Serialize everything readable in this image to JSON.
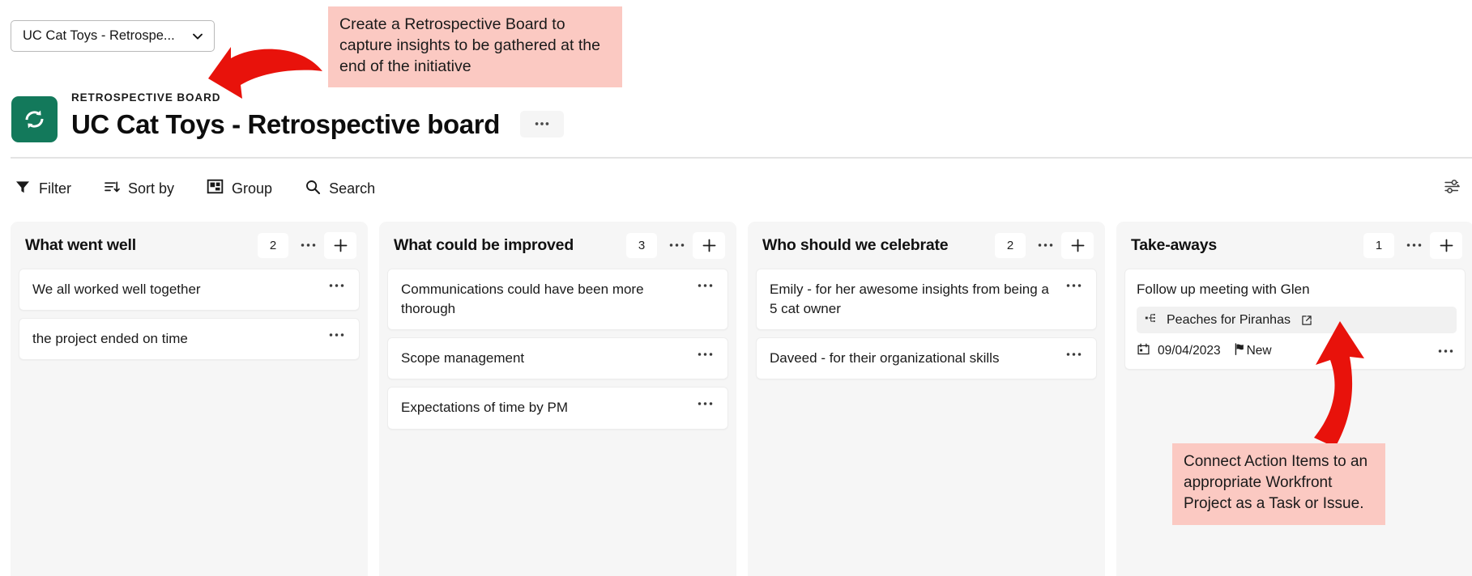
{
  "board_selector": {
    "value": "UC Cat Toys - Retrospe...",
    "icon": "chevron-down-icon"
  },
  "header": {
    "eyebrow": "RETROSPECTIVE BOARD",
    "title": "UC Cat Toys - Retrospective board",
    "more_label": "•••",
    "icon": "sync-refresh-icon",
    "accent_color": "#13795b"
  },
  "toolbar": {
    "items": [
      {
        "label": "Filter",
        "icon": "filter-icon"
      },
      {
        "label": "Sort by",
        "icon": "sort-icon"
      },
      {
        "label": "Group",
        "icon": "group-icon"
      },
      {
        "label": "Search",
        "icon": "search-icon"
      }
    ],
    "settings_icon": "sliders-settings-icon"
  },
  "columns": [
    {
      "title": "What went well",
      "count": "2",
      "more_label": "•••",
      "add_label": "+",
      "cards": [
        {
          "text": "We all worked well together",
          "dots": "•••"
        },
        {
          "text": "the project ended on time",
          "dots": "•••"
        }
      ]
    },
    {
      "title": "What could be improved",
      "count": "3",
      "more_label": "•••",
      "add_label": "+",
      "cards": [
        {
          "text": "Communications could have been more thorough",
          "dots": "•••"
        },
        {
          "text": "Scope management",
          "dots": "•••"
        },
        {
          "text": "Expectations of time by PM",
          "dots": "•••"
        }
      ]
    },
    {
      "title": "Who should we celebrate",
      "count": "2",
      "more_label": "•••",
      "add_label": "+",
      "cards": [
        {
          "text": "Emily - for her awesome insights from being a 5 cat owner",
          "dots": "•••"
        },
        {
          "text": "Daveed - for their organizational skills",
          "dots": "•••"
        }
      ]
    },
    {
      "title": "Take-aways",
      "count": "1",
      "more_label": "•••",
      "add_label": "+",
      "cards": [
        {
          "text": "Follow up meeting with Glen",
          "dots": "•••",
          "linked_item": {
            "name": "Peaches for Piranhas",
            "icon": "work-item-icon",
            "external_icon": "external-link-icon"
          },
          "meta": {
            "date": "09/04/2023",
            "date_icon": "calendar-icon",
            "status": "New",
            "status_icon": "flag-icon"
          }
        }
      ]
    }
  ],
  "annotations": [
    {
      "id": "top",
      "text": "Create a Retrospective Board to capture insights to be gathered at the end of the initiative",
      "bg_color": "#fbc9c2",
      "arrow_color": "#e8120b"
    },
    {
      "id": "bottom",
      "text": "Connect Action Items to an appropriate Workfront Project as a Task or Issue.",
      "bg_color": "#fbc9c2",
      "arrow_color": "#e8120b"
    }
  ]
}
